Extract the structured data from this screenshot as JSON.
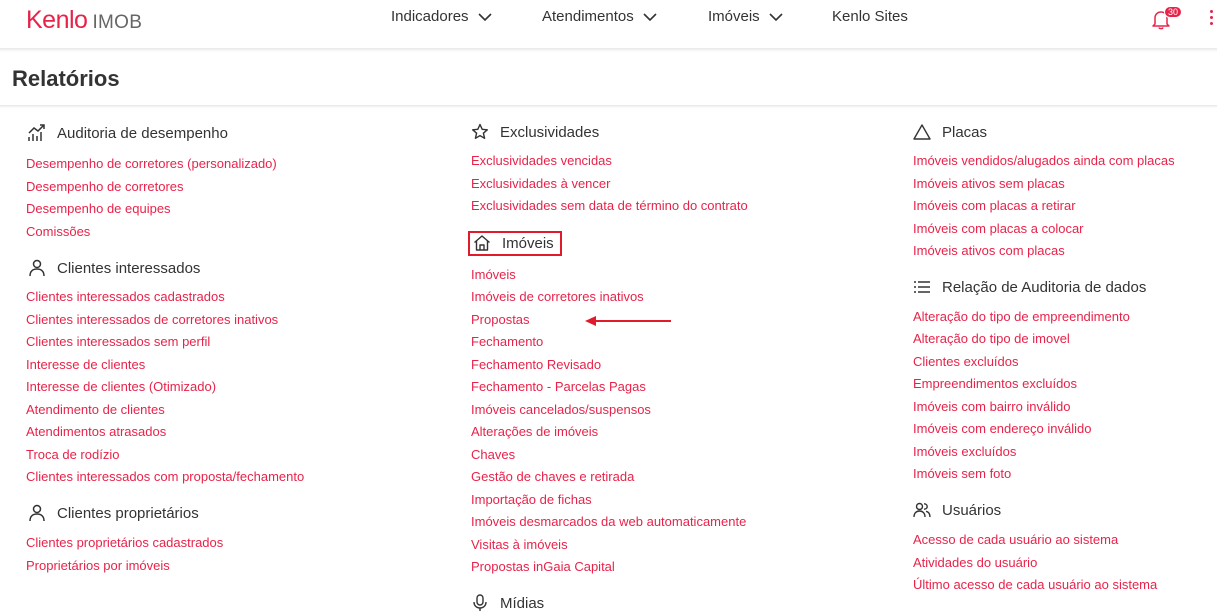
{
  "brand": {
    "name": "Kenlo",
    "product": "IMOB"
  },
  "nav": {
    "indicadores": "Indicadores",
    "atendimentos": "Atendimentos",
    "imoveis": "Imóveis",
    "sites": "Kenlo Sites"
  },
  "notifications": {
    "count": "30"
  },
  "page": {
    "title": "Relatórios"
  },
  "colors": {
    "accent": "#e8234a",
    "highlight": "#e01b2b",
    "text": "#333333"
  },
  "sections": {
    "auditoria": {
      "title": "Auditoria de desempenho",
      "icon": "chart-trend-icon",
      "links": [
        "Desempenho de corretores (personalizado)",
        "Desempenho de corretores",
        "Desempenho de equipes",
        "Comissões"
      ]
    },
    "clientes_interessados": {
      "title": "Clientes interessados",
      "icon": "person-icon",
      "links": [
        "Clientes interessados cadastrados",
        "Clientes interessados de corretores inativos",
        "Clientes interessados sem perfil",
        "Interesse de clientes",
        "Interesse de clientes (Otimizado)",
        "Atendimento de clientes",
        "Atendimentos atrasados",
        "Troca de rodízio",
        "Clientes interessados com proposta/fechamento"
      ]
    },
    "clientes_proprietarios": {
      "title": "Clientes proprietários",
      "icon": "person-icon",
      "links": [
        "Clientes proprietários cadastrados",
        "Proprietários por imóveis"
      ]
    },
    "exclusividades": {
      "title": "Exclusividades",
      "icon": "star-icon",
      "links": [
        "Exclusividades vencidas",
        "Exclusividades à vencer",
        "Exclusividades sem data de término do contrato"
      ]
    },
    "imoveis": {
      "title": "Imóveis",
      "icon": "home-icon",
      "links": [
        "Imóveis",
        "Imóveis de corretores inativos",
        "Propostas",
        "Fechamento",
        "Fechamento Revisado",
        "Fechamento - Parcelas Pagas",
        "Imóveis cancelados/suspensos",
        "Alterações de imóveis",
        "Chaves",
        "Gestão de chaves e retirada",
        "Importação de fichas",
        "Imóveis desmarcados da web automaticamente",
        "Visitas à imóveis",
        "Propostas inGaia Capital"
      ]
    },
    "midias": {
      "title": "Mídias",
      "icon": "microphone-icon"
    },
    "placas": {
      "title": "Placas",
      "icon": "triangle-icon",
      "links": [
        "Imóveis vendidos/alugados ainda com placas",
        "Imóveis ativos sem placas",
        "Imóveis com placas a retirar",
        "Imóveis com placas a colocar",
        "Imóveis ativos com placas"
      ]
    },
    "relacao": {
      "title": "Relação de Auditoria de dados",
      "icon": "list-icon",
      "links": [
        "Alteração do tipo de empreendimento",
        "Alteração do tipo de imovel",
        "Clientes excluídos",
        "Empreendimentos excluídos",
        "Imóveis com bairro inválido",
        "Imóveis com endereço inválido",
        "Imóveis excluídos",
        "Imóveis sem foto"
      ]
    },
    "usuarios": {
      "title": "Usuários",
      "icon": "users-icon",
      "links": [
        "Acesso de cada usuário ao sistema",
        "Atividades do usuário",
        "Último acesso de cada usuário ao sistema"
      ]
    }
  }
}
